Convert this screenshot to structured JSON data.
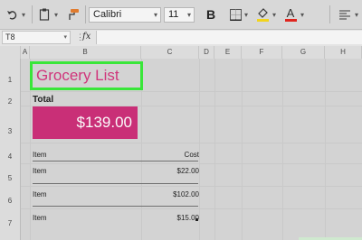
{
  "toolbar": {
    "font_name": "Calibri",
    "font_size": "11",
    "bold_label": "B",
    "font_color_label": "A"
  },
  "formula_bar": {
    "name_box": "T8",
    "fx_label": "fx",
    "dots": "⋮"
  },
  "columns": [
    "A",
    "B",
    "C",
    "D",
    "E",
    "F",
    "G",
    "H"
  ],
  "rows": [
    "1",
    "2",
    "3",
    "4",
    "5",
    "6",
    "7"
  ],
  "sheet": {
    "title": "Grocery List",
    "total_label": "Total",
    "total_value": "$139.00",
    "header_item": "Item",
    "header_cost": "Cost",
    "items": [
      {
        "name": "Item",
        "cost": "$22.00"
      },
      {
        "name": "Item",
        "cost": "$102.00"
      },
      {
        "name": "Item",
        "cost": "$15.00"
      }
    ]
  },
  "colors": {
    "title_text": "#d0357b",
    "title_border": "#39e639",
    "total_fill": "#c92f77"
  }
}
